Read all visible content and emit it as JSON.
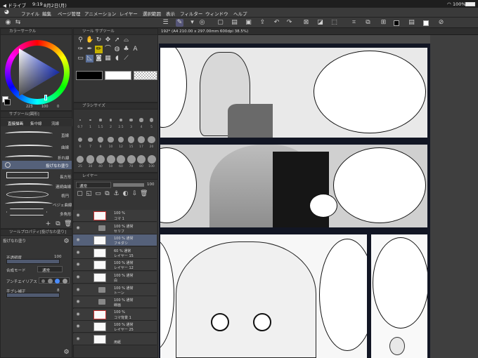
{
  "status_bar": {
    "app": "◀ ドライブ",
    "time": "9:19",
    "date": "8月2日(月)",
    "battery": "100%"
  },
  "menu": [
    "ファイル",
    "編集",
    "ページ管理",
    "アニメーション",
    "レイヤー",
    "選択範囲",
    "表示",
    "フィルター",
    "ウィンドウ",
    "ヘルプ"
  ],
  "color_panel": {
    "title": "カラーサークル",
    "hsv": "223",
    "sat": "100",
    "val": "0"
  },
  "tool_panel": {
    "tab1": "ツール",
    "tab2": "サブツール"
  },
  "subtool_panel": {
    "title": "サブツール[図形]",
    "tabs": [
      "直接描画",
      "集中線",
      "流線"
    ],
    "items": [
      "直線",
      "曲線",
      "折れ線",
      "投げなわ塗り",
      "長方形",
      "連続曲線",
      "楕円",
      "ベジェ曲線",
      "多角形"
    ],
    "selected_index": 3
  },
  "brush_size": {
    "title": "ブラシサイズ",
    "sizes": [
      "0.7",
      "1",
      "1.5",
      "2",
      "2.5",
      "3",
      "4",
      "5",
      "6",
      "7",
      "8",
      "10",
      "12",
      "15",
      "17",
      "20",
      "25",
      "30",
      "40",
      "50",
      "60",
      "70",
      "80",
      "100"
    ]
  },
  "tool_property": {
    "title": "ツールプロパティ[投げなわ塗り]",
    "name": "投げなわ塗り",
    "opacity_label": "不透明度",
    "opacity_value": "100",
    "blend_label": "合成モード",
    "blend_value": "通常",
    "antialias_label": "アンチエイリアス",
    "correction_label": "手ブレ補正",
    "correction_value": "8"
  },
  "layer_panel": {
    "title": "レイヤー",
    "blend": "通常",
    "opacity": "100",
    "layers": [
      {
        "l1": "100 %",
        "l2": "コマ 1",
        "kind": "frame"
      },
      {
        "l1": "100 % 通常",
        "l2": "セリフ",
        "kind": "folder"
      },
      {
        "l1": "100 % 通常",
        "l2": "フキダシ",
        "kind": "layer",
        "selected": true
      },
      {
        "l1": "60 % 通常",
        "l2": "レイヤー 15",
        "kind": "layer"
      },
      {
        "l1": "100 % 通常",
        "l2": "レイヤー 12",
        "kind": "layer"
      },
      {
        "l1": "100 % 通常",
        "l2": "白",
        "kind": "layer"
      },
      {
        "l1": "100 % 通常",
        "l2": "トーン",
        "kind": "folder"
      },
      {
        "l1": "100 % 通常",
        "l2": "線画",
        "kind": "folder"
      },
      {
        "l1": "100 %",
        "l2": "コマ背景 1",
        "kind": "frame"
      },
      {
        "l1": "100 % 通常",
        "l2": "レイヤー 25",
        "kind": "layer"
      },
      {
        "l1": "",
        "l2": "用紙",
        "kind": "paper"
      }
    ]
  },
  "document_tab": "192* (A4 210.00 x 297.00mm 600dpi 38.5%)",
  "colors": {
    "fg": "#000000",
    "bg": "#ffffff",
    "accent": "#4a8cff"
  }
}
